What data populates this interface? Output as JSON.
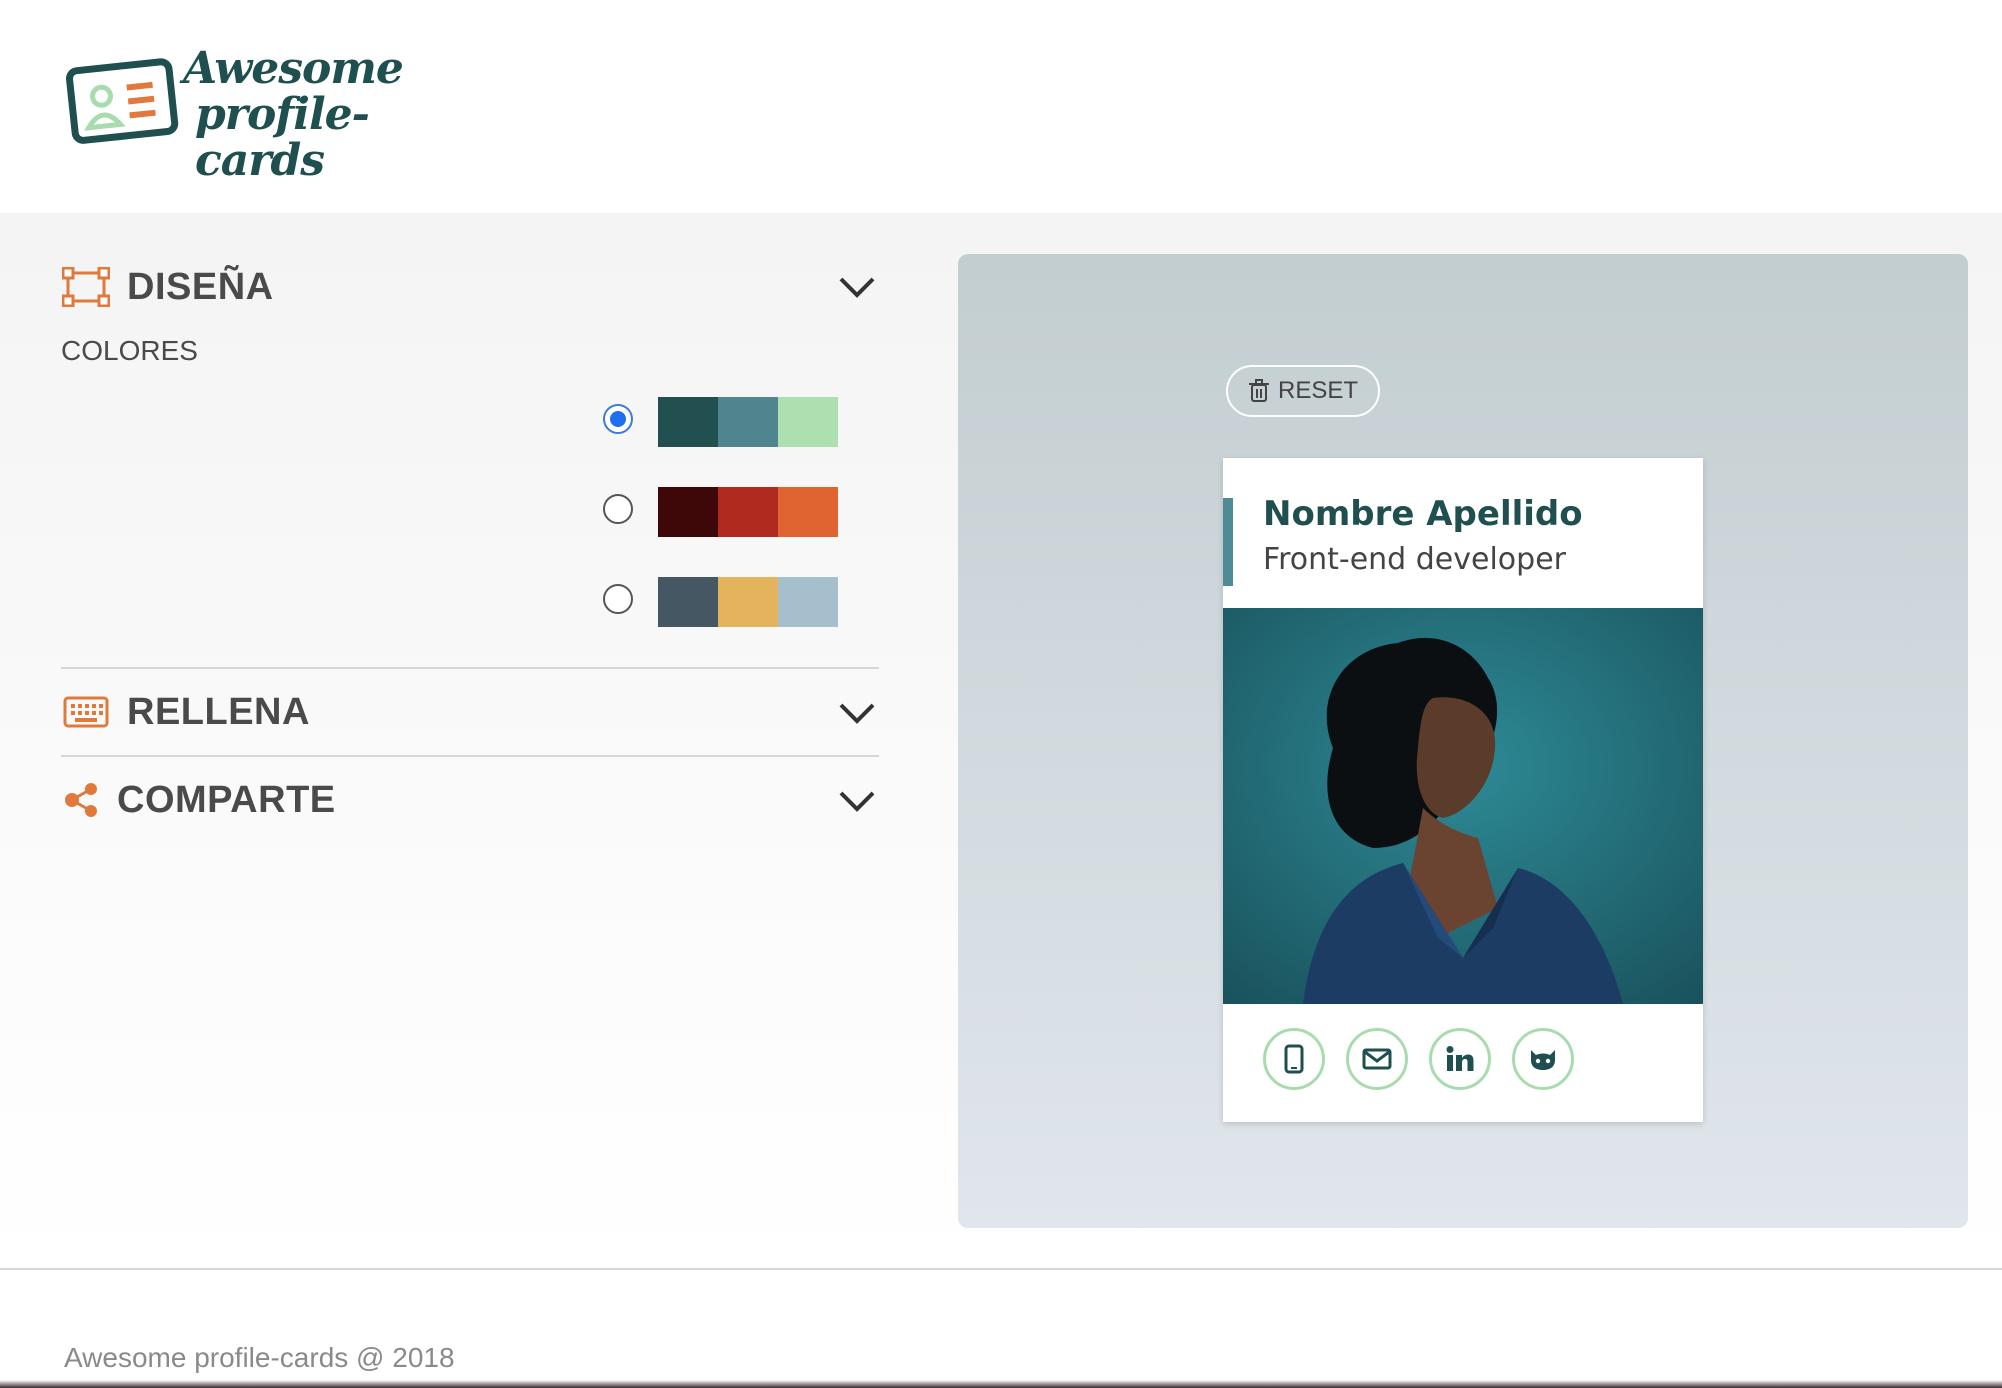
{
  "app": {
    "logo_line1": "Awesome",
    "logo_line2": "profile-cards"
  },
  "design": {
    "title": "DISEÑA",
    "colors_label": "COLORES",
    "palettes": [
      {
        "selected": true,
        "colors": [
          "#224f4f",
          "#508590",
          "#aedfb0"
        ]
      },
      {
        "selected": false,
        "colors": [
          "#3f0808",
          "#b12a1f",
          "#e06432"
        ]
      },
      {
        "selected": false,
        "colors": [
          "#445762",
          "#e4b35e",
          "#a5bfcd"
        ]
      }
    ]
  },
  "fill": {
    "title": "RELLENA"
  },
  "share": {
    "title": "COMPARTE"
  },
  "preview": {
    "reset_label": "RESET",
    "card": {
      "name": "Nombre Apellido",
      "job": "Front-end developer",
      "icons": [
        "mobile-icon",
        "email-icon",
        "linkedin-icon",
        "github-icon"
      ]
    }
  },
  "footer": {
    "text": "Awesome profile-cards @ 2018"
  },
  "colors": {
    "accent": "#e07a3c",
    "brand": "#1f4f4f",
    "icon_border": "#a8dcae"
  }
}
